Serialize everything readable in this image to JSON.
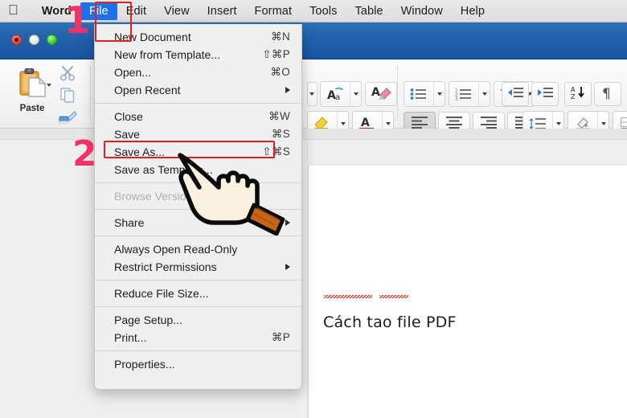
{
  "menubar": {
    "apple_icon": "apple-logo-icon",
    "items": [
      {
        "label": "Word",
        "bold": true,
        "active": false
      },
      {
        "label": "File",
        "bold": false,
        "active": true
      },
      {
        "label": "Edit",
        "bold": false,
        "active": false
      },
      {
        "label": "View",
        "bold": false,
        "active": false
      },
      {
        "label": "Insert",
        "bold": false,
        "active": false
      },
      {
        "label": "Format",
        "bold": false,
        "active": false
      },
      {
        "label": "Tools",
        "bold": false,
        "active": false
      },
      {
        "label": "Table",
        "bold": false,
        "active": false
      },
      {
        "label": "Window",
        "bold": false,
        "active": false
      },
      {
        "label": "Help",
        "bold": false,
        "active": false
      }
    ]
  },
  "window": {
    "titlebar_color": "#1f5ea8",
    "traffic_lights": [
      "close-red",
      "minimize-grey",
      "zoom-green"
    ]
  },
  "ribbon": {
    "paste_label": "Paste",
    "clipboard_icons": [
      "paste-clipboard-icon",
      "cut-scissors-icon",
      "copy-icon",
      "format-painter-icon"
    ],
    "format_icons": [
      "text-effects-icon",
      "highlight-color-icon",
      "font-color-icon",
      "bullet-list-icon",
      "numbered-list-icon",
      "multilevel-list-icon",
      "decrease-indent-icon",
      "increase-indent-icon",
      "sort-az-icon",
      "show-formatting-marks-icon",
      "align-left-icon",
      "align-center-icon",
      "align-right-icon",
      "align-justify-icon",
      "line-spacing-icon",
      "shading-icon",
      "borders-icon"
    ]
  },
  "file_menu": {
    "groups": [
      {
        "items": [
          {
            "label": "New Document",
            "shortcut": "⌘N",
            "disabled": false,
            "submenu": false
          },
          {
            "label": "New from Template...",
            "shortcut": "⇧⌘P",
            "disabled": false,
            "submenu": false
          },
          {
            "label": "Open...",
            "shortcut": "⌘O",
            "disabled": false,
            "submenu": false
          },
          {
            "label": "Open Recent",
            "shortcut": "",
            "disabled": false,
            "submenu": true
          }
        ]
      },
      {
        "items": [
          {
            "label": "Close",
            "shortcut": "⌘W",
            "disabled": false,
            "submenu": false
          },
          {
            "label": "Save",
            "shortcut": "⌘S",
            "disabled": false,
            "submenu": false
          },
          {
            "label": "Save As...",
            "shortcut": "⇧⌘S",
            "disabled": false,
            "submenu": false
          },
          {
            "label": "Save as Template...",
            "shortcut": "",
            "disabled": false,
            "submenu": false
          }
        ]
      },
      {
        "items": [
          {
            "label": "Browse Version History...",
            "shortcut": "",
            "disabled": true,
            "submenu": false
          }
        ]
      },
      {
        "items": [
          {
            "label": "Share",
            "shortcut": "",
            "disabled": false,
            "submenu": true
          }
        ]
      },
      {
        "items": [
          {
            "label": "Always Open Read-Only",
            "shortcut": "",
            "disabled": false,
            "submenu": false
          },
          {
            "label": "Restrict Permissions",
            "shortcut": "",
            "disabled": false,
            "submenu": true
          }
        ]
      },
      {
        "items": [
          {
            "label": "Reduce File Size...",
            "shortcut": "",
            "disabled": false,
            "submenu": false
          }
        ]
      },
      {
        "items": [
          {
            "label": "Page Setup...",
            "shortcut": "",
            "disabled": false,
            "submenu": false
          },
          {
            "label": "Print...",
            "shortcut": "⌘P",
            "disabled": false,
            "submenu": false
          }
        ]
      },
      {
        "items": [
          {
            "label": "Properties...",
            "shortcut": "",
            "disabled": false,
            "submenu": false
          }
        ]
      }
    ]
  },
  "document": {
    "body_text": "Cách tao file PDF",
    "spellcheck_underlines": 2
  },
  "annotations": {
    "step_1": "1",
    "step_2": "2",
    "highlight_color": "#e02020",
    "marker_color": "#ef3366",
    "highlighted_targets": [
      "File",
      "Save As..."
    ],
    "cursor": "pointing-hand-cursor"
  }
}
